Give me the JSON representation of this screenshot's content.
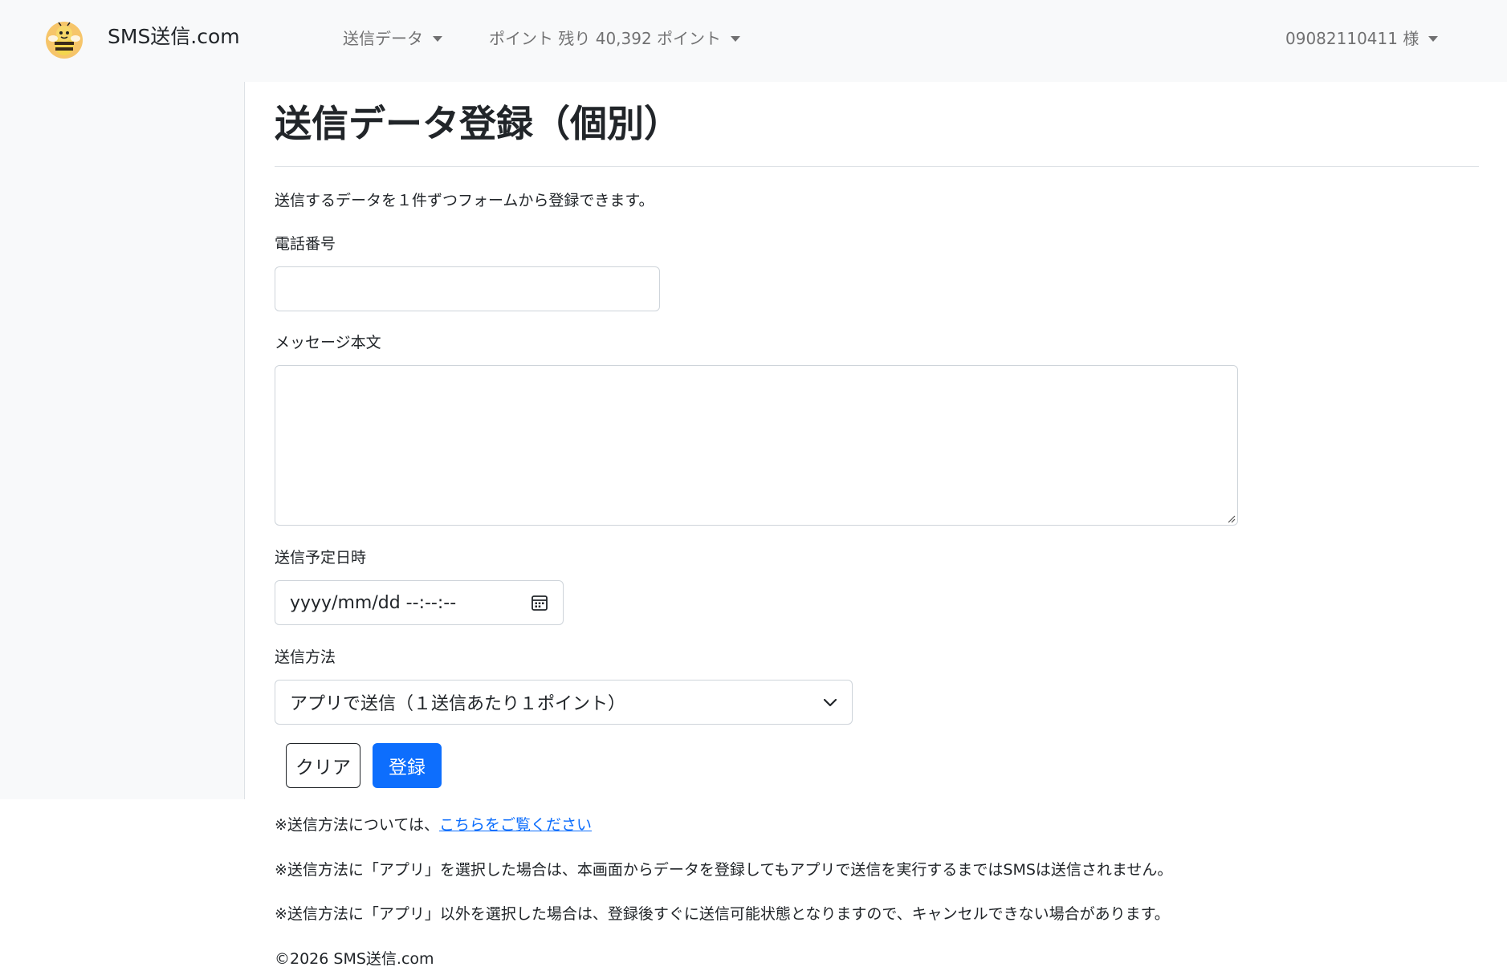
{
  "navbar": {
    "brand": "SMS送信.com",
    "menu_send_data": "送信データ",
    "menu_points": "ポイント 残り 40,392 ポイント",
    "menu_user": "09082110411 様"
  },
  "main": {
    "title": "送信データ登録（個別）",
    "lead": "送信するデータを１件ずつフォームから登録できます。"
  },
  "form": {
    "phone_label": "電話番号",
    "phone_value": "",
    "message_label": "メッセージ本文",
    "message_value": "",
    "schedule_label": "送信予定日時",
    "schedule_placeholder": "yyyy/mm/dd --:--:--",
    "method_label": "送信方法",
    "method_selected": "アプリで送信（１送信あたり１ポイント）",
    "clear_label": "クリア",
    "submit_label": "登録"
  },
  "notes": {
    "note1_prefix": "※送信方法については、",
    "note1_link": "こちらをご覧ください",
    "note2": "※送信方法に「アプリ」を選択した場合は、本画面からデータを登録してもアプリで送信を実行するまではSMSは送信されません。",
    "note3": "※送信方法に「アプリ」以外を選択した場合は、登録後すぐに送信可能状態となりますので、キャンセルできない場合があります。"
  },
  "footer": {
    "copyright": "©2026 SMS送信.com"
  },
  "icons": {
    "logo": "bee-logo-icon",
    "caret": "caret-down-icon",
    "calendar": "calendar-icon",
    "select_chevron": "chevron-down-icon"
  },
  "colors": {
    "primary": "#0d6efd",
    "navbar_bg": "#f8f9fa"
  }
}
